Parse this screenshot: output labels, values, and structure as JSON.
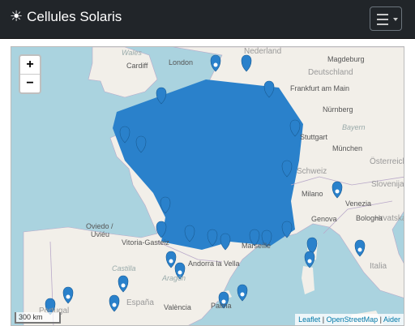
{
  "navbar": {
    "brand_icon": "sun-icon",
    "brand_title": "Cellules Solaris",
    "menu_icon": "hamburger-menu-icon"
  },
  "map": {
    "zoom_in": "+",
    "zoom_out": "−",
    "scale_label": "300 km",
    "attribution": {
      "leaflet": "Leaflet",
      "separator": "|",
      "osm": "OpenStreetMap",
      "help": "Aider"
    },
    "labels": {
      "wales": "Wales",
      "cardiff": "Cardiff",
      "london": "London",
      "nederland": "Nederland",
      "magdeburg": "Magdeburg",
      "deutschland": "Deutschland",
      "frankfurt": "Frankfurt am Main",
      "nurnberg": "Nürnberg",
      "bayern": "Bayern",
      "stuttgart": "Stuttgart",
      "munchen": "München",
      "schweiz": "Schweiz",
      "osterreich": "Österreich",
      "slovenija": "Slovenija",
      "milano": "Milano",
      "venezia": "Venezia",
      "hrvatska": "Hrvatska",
      "genova": "Genova",
      "bologna": "Bologna",
      "italia": "Italia",
      "marseille": "Marseille",
      "andorra": "Andorra la Vella",
      "vitoria": "Vitoria-Gasteiz",
      "oviedo": "Oviedo /",
      "uvieu": "Uviéu",
      "castilla": "Castilla",
      "aragon": "Aragón",
      "espana": "España",
      "valencia": "València",
      "palma": "Palma",
      "portugal": "Portugal"
    },
    "colors": {
      "marker": "#2a81cb",
      "sea": "#aad3df",
      "land": "#f2efe9"
    }
  }
}
